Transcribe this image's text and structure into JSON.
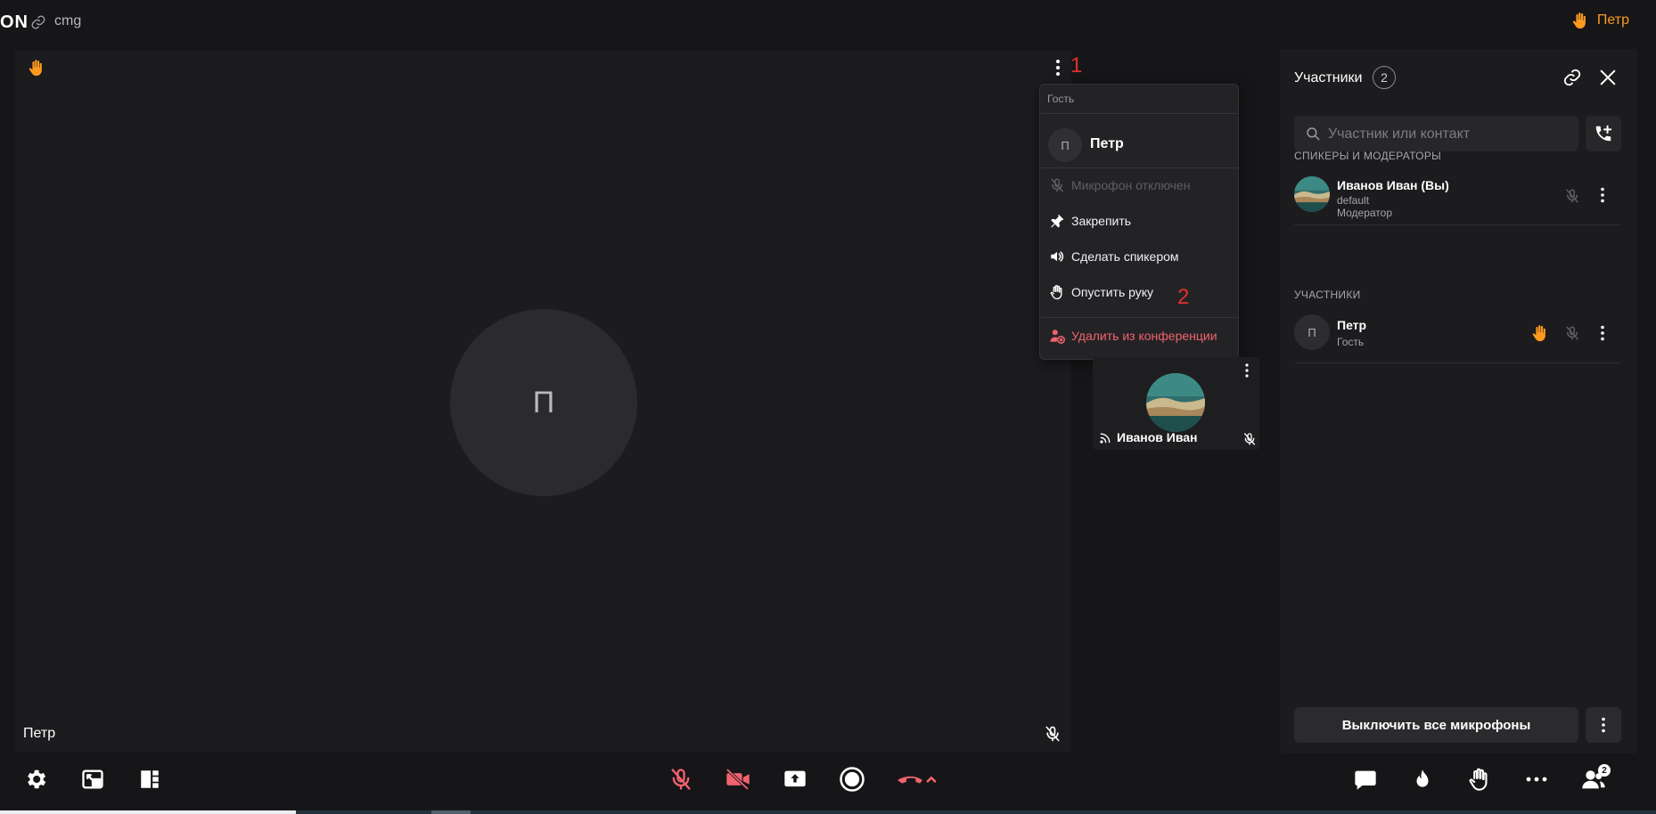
{
  "header": {
    "brand": "ON",
    "room_name": "cmg",
    "user_name": "Петр"
  },
  "stage": {
    "avatar_initial": "П",
    "participant_name": "Петр",
    "marker": "1"
  },
  "context_menu": {
    "role": "Гость",
    "avatar_initial": "П",
    "name": "Петр",
    "items": [
      {
        "label": "Микрофон отключен",
        "icon": "mic-off-icon",
        "disabled": true
      },
      {
        "label": "Закрепить",
        "icon": "pin-icon"
      },
      {
        "label": "Сделать спикером",
        "icon": "speaker-icon"
      },
      {
        "label": "Опустить руку",
        "icon": "lower-hand-icon"
      },
      {
        "label": "Удалить из конференции",
        "icon": "remove-user-icon",
        "danger": true
      }
    ],
    "marker": "2"
  },
  "tile": {
    "name": "Иванов Иван"
  },
  "panel": {
    "title": "Участники",
    "count": "2",
    "search_placeholder": "Участник или контакт",
    "section_speakers": "СПИКЕРЫ И МОДЕРАТОРЫ",
    "section_participants": "УЧАСТНИКИ",
    "speakers": [
      {
        "name": "Иванов Иван (Вы)",
        "sub1": "default",
        "sub2": "Модератор"
      }
    ],
    "participants": [
      {
        "avatar_initial": "П",
        "name": "Петр",
        "sub1": "Гость",
        "hand_raised": true
      }
    ],
    "mute_all_label": "Выключить все микрофоны"
  },
  "toolbar": {
    "participants_badge": "2"
  },
  "colors": {
    "accent_orange": "#ff9a1f",
    "danger_red": "#f1636e",
    "marker_red": "#e0312e",
    "background": "#161618",
    "panel": "#1c1c1f"
  }
}
